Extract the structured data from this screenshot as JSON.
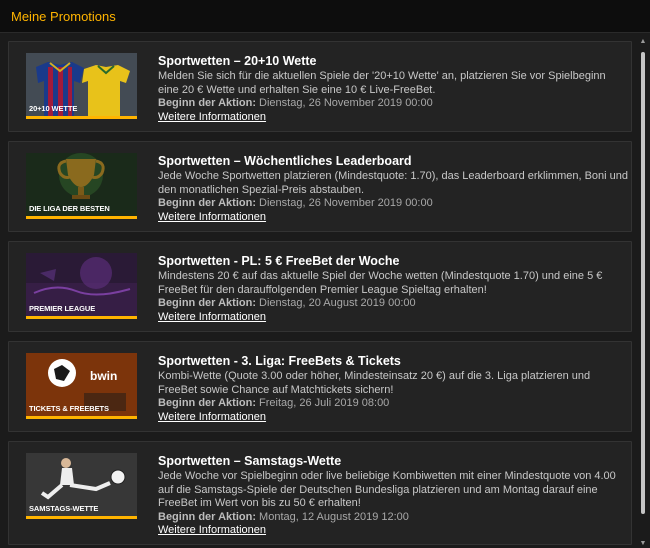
{
  "header": {
    "title": "Meine Promotions"
  },
  "promotions": [
    {
      "thumb_label": "20+10 WETTE",
      "title": "Sportwetten – 20+10 Wette",
      "description": "Melden Sie sich für die aktuellen Spiele der '20+10 Wette' an, platzieren Sie vor Spielbeginn eine 20 € Wette und erhalten Sie eine 10 € Live-FreeBet.",
      "start_label": "Beginn der Aktion:",
      "start_value": "Dienstag, 26 November 2019 00:00",
      "more_label": "Weitere Informationen"
    },
    {
      "thumb_label": "DIE LIGA DER BESTEN",
      "title": "Sportwetten – Wöchentliches Leaderboard",
      "description": "Jede Woche Sportwetten platzieren (Mindestquote: 1.70), das Leaderboard erklimmen, Boni und den monatlichen Spezial-Preis abstauben.",
      "start_label": "Beginn der Aktion:",
      "start_value": "Dienstag, 26 November 2019 00:00",
      "more_label": "Weitere Informationen"
    },
    {
      "thumb_label": "PREMIER LEAGUE",
      "title": "Sportwetten - PL: 5 € FreeBet der Woche",
      "description": "Mindestens 20 € auf das aktuelle Spiel der Woche wetten (Mindestquote 1.70) und eine 5 € FreeBet für den darauffolgenden Premier League Spieltag erhalten!",
      "start_label": "Beginn der Aktion:",
      "start_value": "Dienstag, 20 August 2019 00:00",
      "more_label": "Weitere Informationen"
    },
    {
      "thumb_label": "TICKETS & FREEBETS",
      "thumb_brand": "bwin",
      "title": "Sportwetten - 3. Liga: FreeBets & Tickets",
      "description": "Kombi-Wette (Quote 3.00 oder höher, Mindesteinsatz 20 €) auf die 3. Liga platzieren und FreeBet sowie Chance auf Matchtickets sichern!",
      "start_label": "Beginn der Aktion:",
      "start_value": "Freitag, 26 Juli 2019 08:00",
      "more_label": "Weitere Informationen"
    },
    {
      "thumb_label": "SAMSTAGS-WETTE",
      "title": "Sportwetten – Samstags-Wette",
      "description": "Jede Woche vor Spielbeginn oder live beliebige Kombiwetten mit einer Mindestquote von 4.00 auf die Samstags-Spiele der Deutschen Bundesliga platzieren und am Montag darauf eine FreeBet im Wert von bis zu 50 € erhalten!",
      "start_label": "Beginn der Aktion:",
      "start_value": "Montag, 12 August 2019 12:00",
      "more_label": "Weitere Informationen"
    }
  ],
  "colors": {
    "accent": "#ffb400",
    "background": "#1b1b1b",
    "card": "#232323"
  }
}
